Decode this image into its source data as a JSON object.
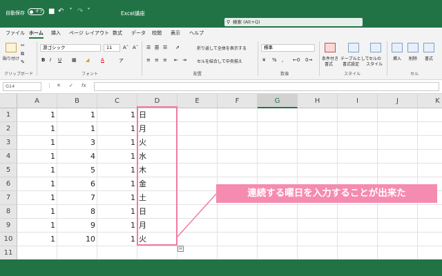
{
  "titlebar": {
    "autosave_label": "自動保存",
    "autosave_state": "オフ",
    "title": "Excel講座",
    "search_placeholder": "検索 (Alt+Q)"
  },
  "ribbon_tabs": [
    "ファイル",
    "ホーム",
    "挿入",
    "ページ レイアウト",
    "数式",
    "データ",
    "校閲",
    "表示",
    "ヘルプ"
  ],
  "active_tab": "ホーム",
  "ribbon": {
    "clipboard": {
      "label": "クリップボード",
      "paste": "貼り付け"
    },
    "font": {
      "label": "フォント",
      "font_name": "游ゴシック",
      "font_size": "11",
      "bold": "B",
      "italic": "I",
      "underline": "U"
    },
    "alignment": {
      "label": "配置",
      "wrap_text": "折り返して全体を表示する",
      "merge_center": "セルを結合して中央揃え"
    },
    "number": {
      "label": "数値",
      "format": "標準"
    },
    "styles": {
      "label": "スタイル",
      "conditional_line1": "条件付き",
      "conditional_line2": "書式",
      "table_line1": "テーブルとして",
      "table_line2": "書式設定",
      "cell_line1": "セルの",
      "cell_line2": "スタイル"
    },
    "cells": {
      "label": "セル",
      "insert": "挿入",
      "delete": "削除",
      "format": "書式"
    }
  },
  "formula_bar": {
    "name_box": "G14",
    "fx": "fx"
  },
  "grid": {
    "columns": [
      "A",
      "B",
      "C",
      "D",
      "E",
      "F",
      "G",
      "H",
      "I",
      "J",
      "K"
    ],
    "selected_column": "G",
    "rows": [
      "1",
      "2",
      "3",
      "4",
      "5",
      "6",
      "7",
      "8",
      "9",
      "10",
      "11"
    ],
    "col_a": [
      "1",
      "1",
      "1",
      "1",
      "1",
      "1",
      "1",
      "1",
      "1",
      "1",
      ""
    ],
    "col_b": [
      "1",
      "1",
      "3",
      "4",
      "5",
      "6",
      "7",
      "8",
      "9",
      "10",
      ""
    ],
    "col_c": [
      "1",
      "1",
      "1",
      "1",
      "1",
      "1",
      "1",
      "1",
      "1",
      "1",
      ""
    ],
    "col_d": [
      "日",
      "月",
      "火",
      "水",
      "木",
      "金",
      "土",
      "日",
      "月",
      "火",
      ""
    ]
  },
  "annotation": {
    "text": "連続する曜日を入力することが出来た"
  },
  "colors": {
    "excel_green": "#217346",
    "highlight_pink": "#f07aa3",
    "callout_pink": "#f58bb0"
  }
}
